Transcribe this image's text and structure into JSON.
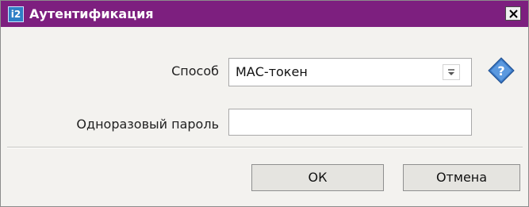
{
  "window": {
    "title": "Аутентификация",
    "icon": "i2-app-icon",
    "icon_glyph": "i2",
    "close_icon": "close-icon"
  },
  "form": {
    "method_label": "Способ",
    "method_value": "МАС-токен",
    "otp_label": "Одноразовый пароль",
    "otp_value": "",
    "help_icon": "help-icon"
  },
  "buttons": {
    "ok_label": "ОК",
    "cancel_label": "Отмена"
  },
  "colors": {
    "titlebar": "#7d1f7f",
    "dialog_bg": "#f3f2ef",
    "help_icon": "#3a78c4"
  }
}
